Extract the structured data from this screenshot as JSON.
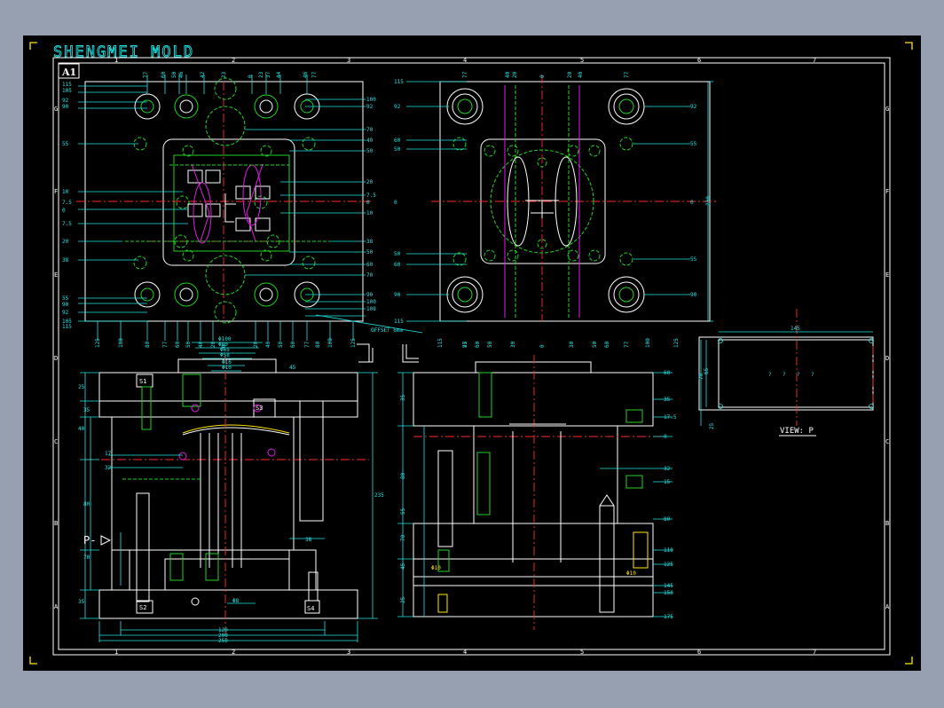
{
  "drawing": {
    "title": "SHENGMEI MOLD",
    "sheet_size": "A1",
    "view_label": "VIEW: P",
    "view_arrow_label": "P-",
    "offset_note": "OFFSET 6mm",
    "column_labels": [
      "1",
      "2",
      "3",
      "4",
      "5",
      "6",
      "7"
    ],
    "row_labels": [
      "G",
      "F",
      "E",
      "D",
      "C",
      "B",
      "A"
    ],
    "colors": {
      "background": "#000000",
      "outline": "#ffffff",
      "dimension": "#22e5e5",
      "hidden": "#22d422",
      "center": "#ff2a2a",
      "cooling": "#e11ee1",
      "window": "#96a0b0"
    }
  },
  "top_left_dims": {
    "left": [
      "115",
      "105",
      "92",
      "90",
      "55",
      "10",
      "7.5",
      "0",
      "7.5",
      "20",
      "38",
      "55",
      "90",
      "92",
      "105",
      "115"
    ],
    "right": [
      "100",
      "92",
      "70",
      "40",
      "50",
      "20",
      "7.5",
      "0",
      "10",
      "38",
      "50",
      "60",
      "70",
      "90",
      "100",
      "108"
    ],
    "top": [
      "77",
      "60",
      "50",
      "46",
      "42",
      "23",
      "0",
      "23",
      "37",
      "44",
      "46",
      "77"
    ],
    "bottom": [
      "125",
      "100",
      "80",
      "77",
      "60",
      "50",
      "40",
      "20",
      "0",
      "20",
      "40",
      "50",
      "60",
      "77",
      "80",
      "100",
      "125"
    ],
    "labels": [
      "SA",
      "SB",
      "IN",
      "OUT",
      "S3",
      "S3",
      "S1",
      "S4",
      "S2"
    ]
  },
  "top_right_dims": {
    "left": [
      "115",
      "92",
      "60",
      "50",
      "0",
      "50",
      "60",
      "90",
      "115"
    ],
    "right": [
      "92",
      "55",
      "0",
      "55",
      "90"
    ],
    "overall_width": "230",
    "top": [
      "77",
      "40",
      "20",
      "0",
      "20",
      "40",
      "77"
    ],
    "bottom": [
      "115",
      "85",
      "77",
      "60",
      "50",
      "30",
      "0",
      "30",
      "50",
      "60",
      "77",
      "100",
      "125"
    ],
    "labels": [
      "OUT",
      "IN",
      "OUT",
      "IN"
    ]
  },
  "section_left": {
    "dims_left": [
      "25",
      "40",
      "35",
      "17",
      "32",
      "80",
      "70",
      "35"
    ],
    "dims_right": [
      "235",
      "38",
      "45"
    ],
    "dims_bottom": [
      "120",
      "200",
      "250"
    ],
    "dims_top": [
      "Φ100",
      "Φ80",
      "Φ65",
      "Φ58",
      "Φ16",
      "Φ10",
      "Φ8"
    ],
    "labels": [
      "S1",
      "S2",
      "S4",
      "S3"
    ]
  },
  "section_right": {
    "dims_right": [
      "60",
      "35",
      "17.5",
      "0",
      "32",
      "15",
      "80",
      "110",
      "125",
      "145",
      "150",
      "175"
    ],
    "dims_left": [
      "35",
      "80",
      "70",
      "45",
      "25",
      "55"
    ],
    "labels": [
      "Φ10",
      "Φ10"
    ]
  },
  "view_p": {
    "width": "145",
    "height": "70",
    "depth": "65",
    "offset": "25",
    "marks": [
      "?",
      "?",
      "?",
      "?"
    ]
  }
}
